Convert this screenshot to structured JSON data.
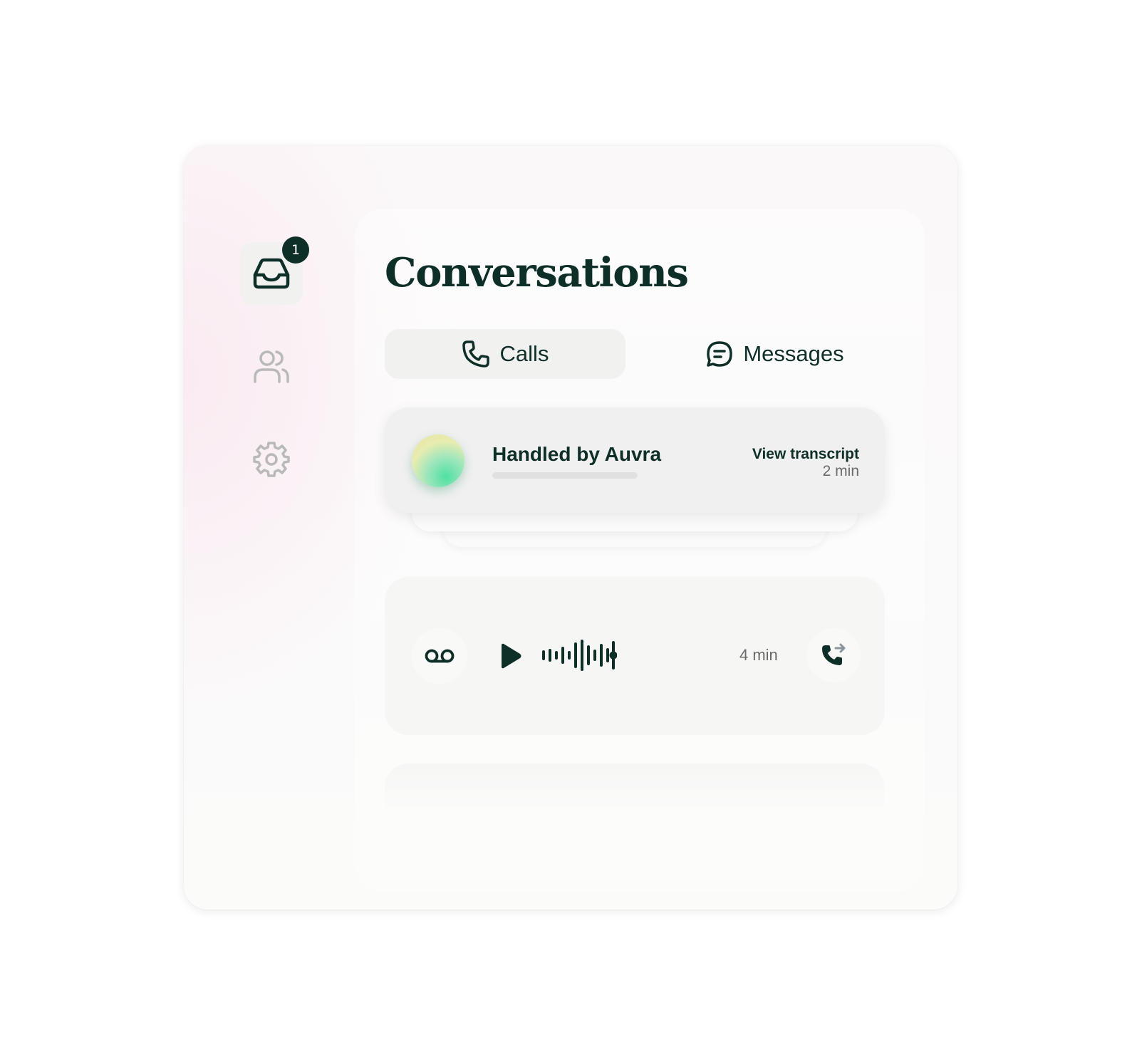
{
  "sidebar": {
    "items": [
      {
        "name": "inbox",
        "icon": "inbox-icon",
        "active": true
      },
      {
        "name": "contacts",
        "icon": "users-icon",
        "active": false
      },
      {
        "name": "settings",
        "icon": "gear-icon",
        "active": false
      }
    ],
    "inbox_badge": "1"
  },
  "header": {
    "title": "Conversations"
  },
  "tabs": [
    {
      "label": "Calls",
      "icon": "phone-icon",
      "active": true
    },
    {
      "label": "Messages",
      "icon": "chat-bubble-icon",
      "active": false
    }
  ],
  "cards": [
    {
      "title": "Handled by Auvra",
      "action_label": "View transcript",
      "duration": "2 min",
      "avatar": "gradient-orb"
    },
    {
      "type": "voicemail",
      "icons": [
        "voicemail-icon",
        "play-icon",
        "waveform-icon",
        "phone-forward-icon"
      ],
      "duration": "4 min"
    }
  ],
  "colors": {
    "accent": "#0e2e28",
    "muted_icon": "#b9b9b9",
    "secondary_text": "#6a6a6a",
    "orb_green": "#4fe0a4",
    "orb_yellow": "#e6e2a0"
  }
}
